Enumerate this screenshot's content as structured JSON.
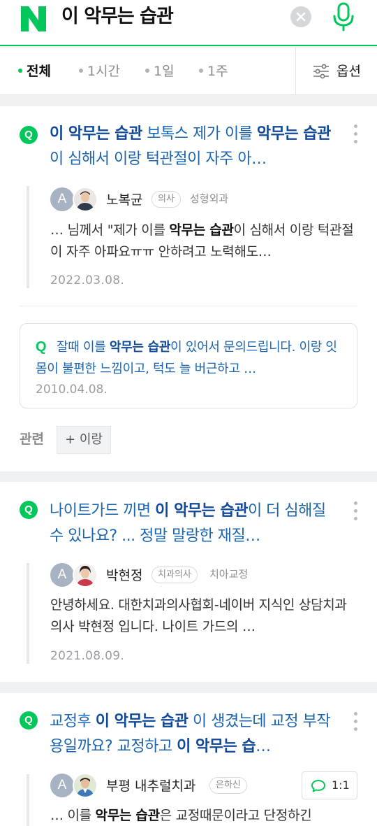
{
  "search": {
    "logo": "N",
    "query": "이 악무는 습관",
    "clear_icon": "close-icon",
    "mic_icon": "mic-icon"
  },
  "filters": {
    "tabs": [
      {
        "label": "전체",
        "active": true
      },
      {
        "label": "1시간",
        "active": false
      },
      {
        "label": "1일",
        "active": false
      },
      {
        "label": "1주",
        "active": false
      }
    ],
    "options_label": "옵션"
  },
  "colors": {
    "brand": "#03c75a",
    "link": "#1a64b0",
    "highlight": "#10489a"
  },
  "results": [
    {
      "title_segments": [
        {
          "text": "이 악무는 습관",
          "bold": true
        },
        {
          "text": " 보톡스 제가 이를 ",
          "bold": false
        },
        {
          "text": "악무는 습관",
          "bold": true
        },
        {
          "text": "이 심해서 이랑 턱관절이 자주 아…",
          "bold": false
        }
      ],
      "author": "노복균",
      "role": "의사",
      "specialty": "성형외과",
      "snippet_segments": [
        {
          "text": "… 님께서 \"제가 이를 ",
          "bold": false
        },
        {
          "text": "악무는 습관",
          "bold": true
        },
        {
          "text": "이 심해서 이랑 턱관절이 자주 아파요ㅠㅠ 안하려고 노력해도…",
          "bold": false
        }
      ],
      "date": "2022.03.08.",
      "related_question": {
        "q_icon": "Q",
        "segments": [
          {
            "text": "잘때 이를 ",
            "bold": false
          },
          {
            "text": "악무는 습관",
            "bold": true
          },
          {
            "text": "이 있어서 문의드립니다. 이랑 잇몸이 불편한 느낌이고, 턱도 늘 버근하고 …",
            "bold": false
          }
        ],
        "date": "2010.04.08."
      },
      "related_label": "관련",
      "related_tag": "+ 이랑"
    },
    {
      "title_segments": [
        {
          "text": "나이트가드 끼면 ",
          "bold": false
        },
        {
          "text": "이 악무는 습관",
          "bold": true
        },
        {
          "text": "이 더 심해질 수 있나요? ... 정말 말랑한 재질…",
          "bold": false
        }
      ],
      "author": "박현정",
      "role": "치과의사",
      "specialty": "치아교정",
      "snippet_segments": [
        {
          "text": "안녕하세요. 대한치과의사협회-네이버 지식인 상담치과의사 박현정 입니다. 나이트 가드의 …",
          "bold": false
        }
      ],
      "date": "2021.08.09."
    },
    {
      "title_segments": [
        {
          "text": "교정후 ",
          "bold": false
        },
        {
          "text": "이 악무는 습관",
          "bold": true
        },
        {
          "text": " 이 생겼는데 교정 부작용일까요? 교정하고 ",
          "bold": false
        },
        {
          "text": "이 악무는 습",
          "bold": true
        },
        {
          "text": "…",
          "bold": false
        }
      ],
      "author": "부평 내추럴치과",
      "role": "은하신",
      "chat_label": "1:1",
      "snippet_segments": [
        {
          "text": "… 이를 ",
          "bold": false
        },
        {
          "text": "악무는 습관",
          "bold": true
        },
        {
          "text": "은 교정때문이라고 단정하긴",
          "bold": false
        }
      ]
    }
  ]
}
